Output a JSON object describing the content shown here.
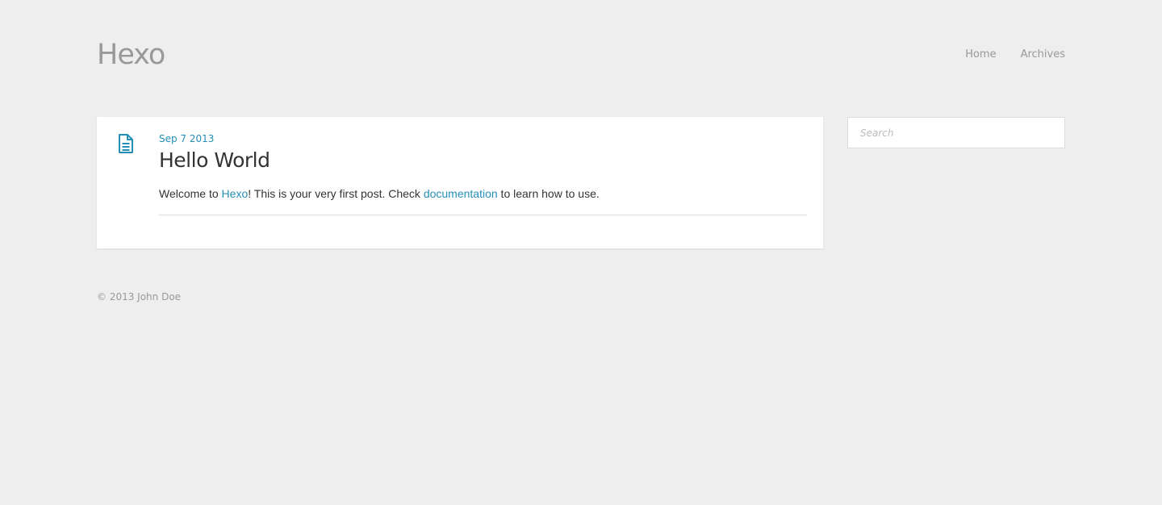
{
  "header": {
    "site_title": "Hexo",
    "nav": [
      {
        "label": "Home"
      },
      {
        "label": "Archives"
      }
    ]
  },
  "post": {
    "icon": "document-icon",
    "date": "Sep 7 2013",
    "title": "Hello World",
    "body": {
      "prefix": "Welcome to ",
      "link1": "Hexo",
      "middle": "! This is your very first post. Check ",
      "link2": "documentation",
      "suffix": " to learn how to use."
    }
  },
  "sidebar": {
    "search_placeholder": "Search"
  },
  "footer": {
    "copyright": "© 2013 John Doe"
  },
  "colors": {
    "background": "#eeeeee",
    "accent": "#258fb8",
    "muted": "#999999",
    "card": "#ffffff"
  }
}
